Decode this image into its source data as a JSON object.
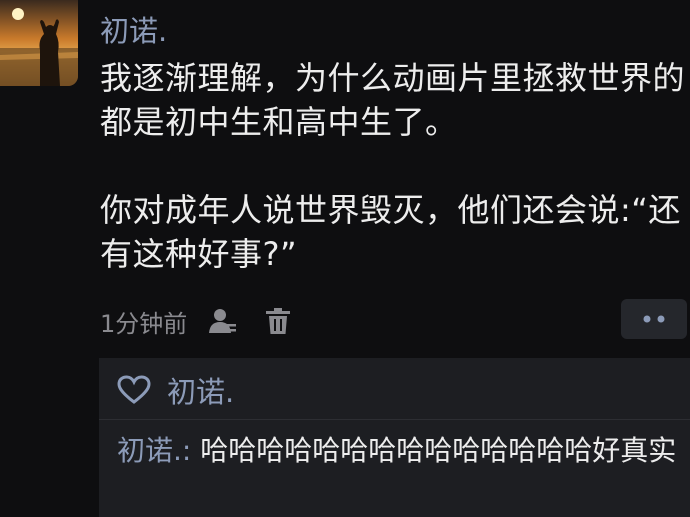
{
  "post": {
    "author": "初诺.",
    "paragraph1": "我逐渐理解，为什么动画片里拯救世界的都是初中生和高中生了。",
    "paragraph2": "你对成年人说世界毁灭，他们还会说:“还有这种好事?”",
    "time": "1分钟前"
  },
  "icons": {
    "avatar": "avatar-sunset-photo",
    "user": "user-icon",
    "delete": "trash-icon",
    "more": "more-dots-icon",
    "like": "heart-outline-icon"
  },
  "likes": {
    "names": "初诺."
  },
  "comment": {
    "author": "初诺.:",
    "text": "哈哈哈哈哈哈哈哈哈哈哈哈哈哈好真实"
  },
  "colors": {
    "background": "#0e0e10",
    "name_link": "#8c9bb8",
    "text": "#ededed",
    "panel": "#1d1e22"
  }
}
